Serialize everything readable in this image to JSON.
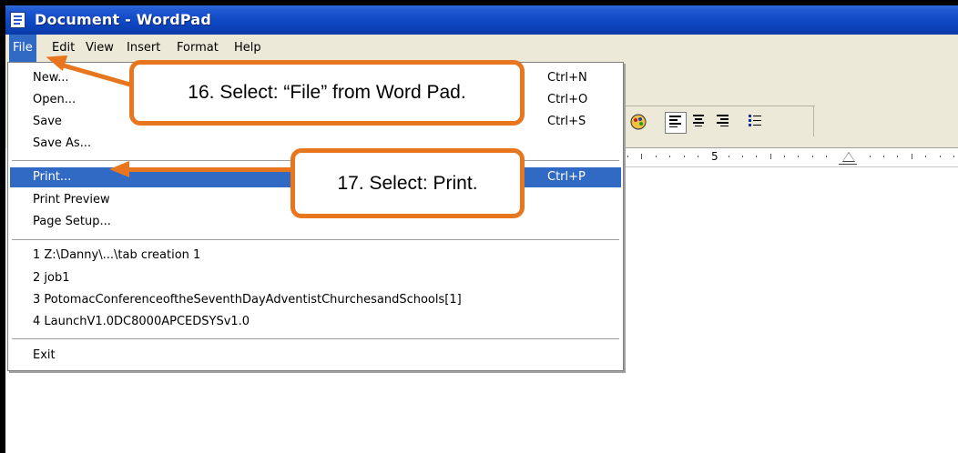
{
  "window": {
    "title": "Document - WordPad",
    "icon": "wordpad-document-icon"
  },
  "menubar": {
    "items": [
      "File",
      "Edit",
      "View",
      "Insert",
      "Format",
      "Help"
    ],
    "active": "File"
  },
  "file_menu": {
    "items": [
      {
        "label": "New...",
        "shortcut": "Ctrl+N"
      },
      {
        "label": "Open...",
        "shortcut": "Ctrl+O"
      },
      {
        "label": "Save",
        "shortcut": "Ctrl+S"
      },
      {
        "label": "Save As...",
        "shortcut": ""
      },
      {
        "label": "Print...",
        "shortcut": "Ctrl+P"
      },
      {
        "label": "Print Preview",
        "shortcut": ""
      },
      {
        "label": "Page Setup...",
        "shortcut": ""
      },
      {
        "label": "1 Z:\\Danny\\...\\tab creation 1",
        "shortcut": ""
      },
      {
        "label": "2 job1",
        "shortcut": ""
      },
      {
        "label": "3 PotomacConferenceoftheSeventhDayAdventistChurchesandSchools[1]",
        "shortcut": ""
      },
      {
        "label": "4 LaunchV1.0DC8000APCEDSYSv1.0",
        "shortcut": ""
      },
      {
        "label": "Exit",
        "shortcut": ""
      }
    ],
    "highlighted": "Print..."
  },
  "toolbar": {
    "icons": [
      "insert-object-icon",
      "align-left-icon",
      "align-center-icon",
      "align-right-icon",
      "bullets-icon"
    ]
  },
  "ruler": {
    "label": "5"
  },
  "callouts": {
    "step16": "16. Select:  “File” from Word Pad.",
    "step17": "17. Select:  Print."
  },
  "colors": {
    "accent": "#e8761e",
    "highlight": "#316ac5",
    "titlebar": "#0d46c2"
  }
}
